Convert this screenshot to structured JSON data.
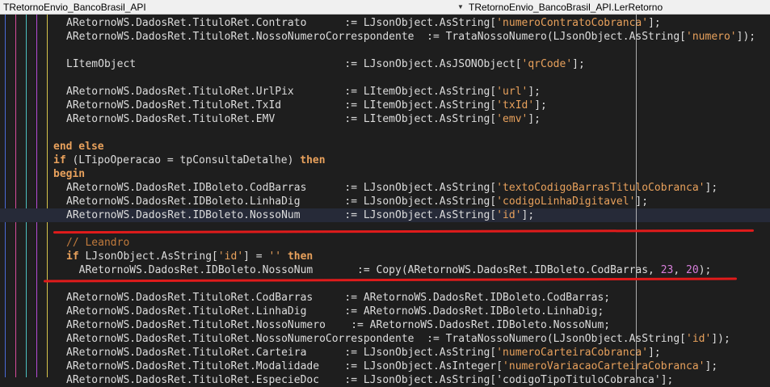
{
  "combo_left": "TRetornoEnvio_BancoBrasil_API",
  "combo_right": "TRetornoEnvio_BancoBrasil_API.LerRetorno",
  "dropdown_glyph": "▼",
  "lines": [
    [
      [
        "ident",
        "ARetornoWS.DadosRet.TituloRet.Contrato      := LJsonObject.AsString["
      ],
      [
        "str",
        "'numeroContratoCobranca'"
      ],
      [
        "ident",
        "];"
      ]
    ],
    [
      [
        "ident",
        "ARetornoWS.DadosRet.TituloRet.NossoNumeroCorrespondente  := TrataNossoNumero(LJsonObject.AsString["
      ],
      [
        "str",
        "'numero'"
      ],
      [
        "ident",
        "]);"
      ]
    ],
    [],
    [
      [
        "ident",
        "LItemObject                                 := LJsonObject.AsJSONObject["
      ],
      [
        "str",
        "'qrCode'"
      ],
      [
        "ident",
        "];"
      ]
    ],
    [],
    [
      [
        "ident",
        "ARetornoWS.DadosRet.TituloRet.UrlPix        := LItemObject.AsString["
      ],
      [
        "str",
        "'url'"
      ],
      [
        "ident",
        "];"
      ]
    ],
    [
      [
        "ident",
        "ARetornoWS.DadosRet.TituloRet.TxId          := LItemObject.AsString["
      ],
      [
        "str",
        "'txId'"
      ],
      [
        "ident",
        "];"
      ]
    ],
    [
      [
        "ident",
        "ARetornoWS.DadosRet.TituloRet.EMV           := LItemObject.AsString["
      ],
      [
        "str",
        "'emv'"
      ],
      [
        "ident",
        "];"
      ]
    ],
    [],
    [
      [
        "kw",
        "end else"
      ]
    ],
    [
      [
        "kw",
        "if"
      ],
      [
        "ident",
        " (LTipoOperacao = tpConsultaDetalhe) "
      ],
      [
        "kw",
        "then"
      ]
    ],
    [
      [
        "kw",
        "begin"
      ]
    ],
    [
      [
        "ident",
        "ARetornoWS.DadosRet.IDBoleto.CodBarras      := LJsonObject.AsString["
      ],
      [
        "str",
        "'textoCodigoBarrasTituloCobranca'"
      ],
      [
        "ident",
        "];"
      ]
    ],
    [
      [
        "ident",
        "ARetornoWS.DadosRet.IDBoleto.LinhaDig       := LJsonObject.AsString["
      ],
      [
        "str",
        "'codigoLinhaDigitavel'"
      ],
      [
        "ident",
        "];"
      ]
    ],
    [
      [
        "ident",
        "ARetornoWS.DadosRet.IDBoleto.NossoNum       := LJsonObject.AsString["
      ],
      [
        "str",
        "'id'"
      ],
      [
        "ident",
        "];"
      ]
    ],
    [],
    [
      [
        "cmt",
        "// Leandro"
      ]
    ],
    [
      [
        "kw",
        "if"
      ],
      [
        "ident",
        " LJsonObject.AsString["
      ],
      [
        "str",
        "'id'"
      ],
      [
        "ident",
        "] = "
      ],
      [
        "str",
        "''"
      ],
      [
        "ident",
        " "
      ],
      [
        "kw",
        "then"
      ]
    ],
    [
      [
        "ident",
        "  ARetornoWS.DadosRet.IDBoleto.NossoNum       := Copy(ARetornoWS.DadosRet.IDBoleto.CodBarras, "
      ],
      [
        "num",
        "23"
      ],
      [
        "ident",
        ", "
      ],
      [
        "num",
        "20"
      ],
      [
        "ident",
        ");"
      ]
    ],
    [],
    [
      [
        "ident",
        "ARetornoWS.DadosRet.TituloRet.CodBarras     := ARetornoWS.DadosRet.IDBoleto.CodBarras;"
      ]
    ],
    [
      [
        "ident",
        "ARetornoWS.DadosRet.TituloRet.LinhaDig      := ARetornoWS.DadosRet.IDBoleto.LinhaDig;"
      ]
    ],
    [
      [
        "ident",
        "ARetornoWS.DadosRet.TituloRet.NossoNumero    := ARetornoWS.DadosRet.IDBoleto.NossoNum;"
      ]
    ],
    [
      [
        "ident",
        "ARetornoWS.DadosRet.TituloRet.NossoNumeroCorrespondente  := TrataNossoNumero(LJsonObject.AsString["
      ],
      [
        "str",
        "'id'"
      ],
      [
        "ident",
        "]);"
      ]
    ],
    [
      [
        "ident",
        "ARetornoWS.DadosRet.TituloRet.Carteira      := LJsonObject.AsString["
      ],
      [
        "str",
        "'numeroCarteiraCobranca'"
      ],
      [
        "ident",
        "];"
      ]
    ],
    [
      [
        "ident",
        "ARetornoWS.DadosRet.TituloRet.Modalidade    := LJsonObject.AsInteger["
      ],
      [
        "str",
        "'numeroVariacaoCarteiraCobranca'"
      ],
      [
        "ident",
        "];"
      ]
    ]
  ],
  "last_line_partial": "ARetornoWS.DadosRet.TituloRet.EspecieDoc    := LJsonObject.AsString['codigoTipoTituloCobranca'];"
}
